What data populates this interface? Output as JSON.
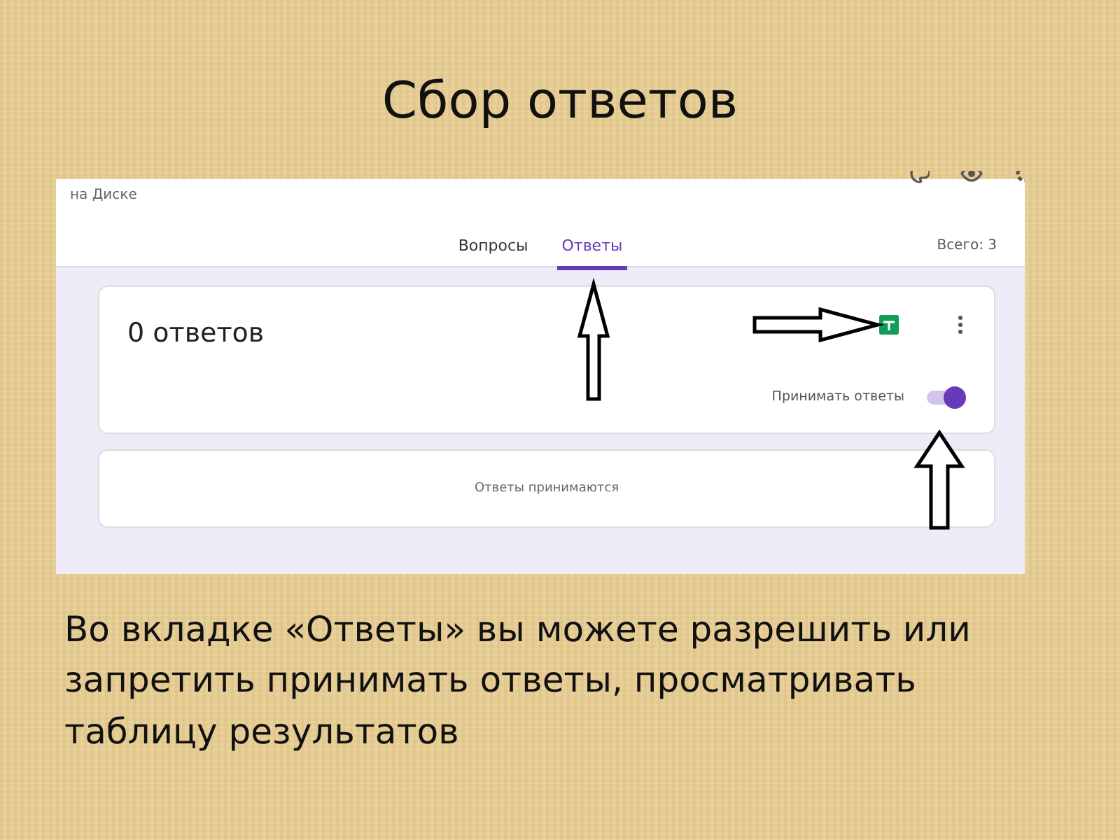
{
  "slide_title": "Сбор ответов",
  "screenshot": {
    "save_status": "на Диске",
    "tabs": [
      {
        "label": "Вопросы",
        "selected": false
      },
      {
        "label": "Ответы",
        "selected": true
      }
    ],
    "total": "Всего: 3",
    "summary_card": {
      "count": "0 ответов",
      "toggle_label": "Принимать ответы",
      "accepting": true
    },
    "status_card": {
      "text": "Ответы принимаются"
    }
  },
  "caption": "Во вкладке «Ответы» вы можете разрешить или запретить принимать ответы, просматривать таблицу результатов"
}
